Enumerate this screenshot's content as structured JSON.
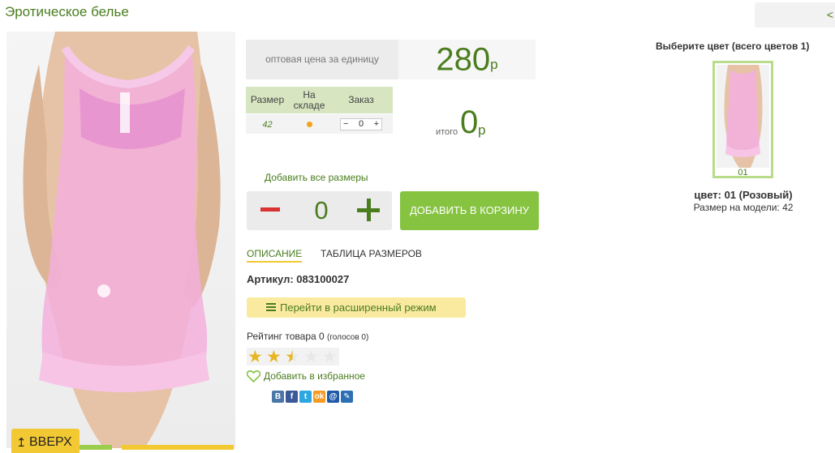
{
  "page": {
    "title": "Эротическое белье",
    "back_label": "<"
  },
  "product": {
    "image_icon": "nightgown-photo",
    "price_label": "оптовая цена за единицу",
    "price_value": "280",
    "currency": "р",
    "size_table": {
      "headers": [
        "Размер",
        "На складе",
        "Заказ"
      ],
      "rows": [
        {
          "size": "42",
          "in_stock": true,
          "order_qty": "0",
          "minus": "−",
          "plus": "+"
        }
      ]
    },
    "total_label": "итого",
    "total_value": "0",
    "total_currency": "р",
    "add_all_sizes": "Добавить все размеры",
    "quantity": {
      "minus": "−",
      "value": "0",
      "plus": "+"
    },
    "add_to_cart": "ДОБАВИТЬ В КОРЗИНУ",
    "tabs": [
      {
        "label": "ОПИСАНИЕ",
        "active": true
      },
      {
        "label": "ТАБЛИЦА РАЗМЕРОВ",
        "active": false
      }
    ],
    "sku": "Артикул: 083100027",
    "advanced_mode": "Перейти в расширенный режим",
    "rating_text": "Рейтинг товара 0",
    "rating_votes": "(голосов 0)",
    "rating_stars": 2.5,
    "favorite": "Добавить в избранное",
    "share": [
      {
        "icon": "vk-icon",
        "glyph": "В",
        "color": "#4a76a8"
      },
      {
        "icon": "facebook-icon",
        "glyph": "f",
        "color": "#3b5998"
      },
      {
        "icon": "twitter-icon",
        "glyph": "t",
        "color": "#2ea7e0"
      },
      {
        "icon": "odnoklassniki-icon",
        "glyph": "ok",
        "color": "#f59a23"
      },
      {
        "icon": "mailru-icon",
        "glyph": "@",
        "color": "#1d5aa8"
      },
      {
        "icon": "livejournal-icon",
        "glyph": "✎",
        "color": "#2d6fb4"
      }
    ]
  },
  "colors": {
    "heading": "Выберите цвет (всего цветов 1)",
    "items": [
      {
        "code": "01"
      }
    ],
    "selected": "цвет: 01 (Розовый)",
    "model_size": "Размер на модели: 42"
  },
  "up_button": {
    "arrow": "↥",
    "label": "ВВЕРХ"
  },
  "colors_theme": {
    "accent_green": "#4a7d1e",
    "button_green": "#85c341",
    "yellow": "#f3c933",
    "pink": "#f2a9d8"
  }
}
